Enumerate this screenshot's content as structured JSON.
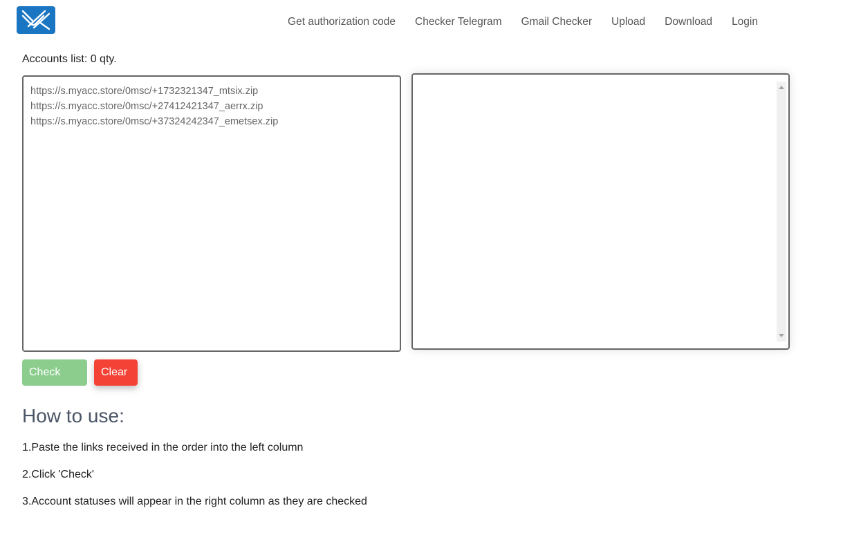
{
  "nav": {
    "items": [
      {
        "label": "Get authorization code"
      },
      {
        "label": "Checker Telegram"
      },
      {
        "label": "Gmail Checker"
      },
      {
        "label": "Upload"
      },
      {
        "label": "Download"
      },
      {
        "label": "Login"
      }
    ]
  },
  "accounts_label": "Accounts list: 0 qty.",
  "input_links_placeholder": "https://s.myacc.store/0msc/+1732321347_mtsix.zip\nhttps://s.myacc.store/0msc/+27412421347_aerrx.zip\nhttps://s.myacc.store/0msc/+37324242347_emetsex.zip",
  "results_value": "",
  "buttons": {
    "check": "Check",
    "clear": "Clear"
  },
  "howto": {
    "title": "How to use:",
    "steps": [
      "1.Paste the links received in the order into the left column",
      "2.Click 'Check'",
      "3.Account statuses will appear in the right column as they are checked"
    ]
  },
  "colors": {
    "logo": "#1a76c2",
    "check_button": "#8ccd8e",
    "clear_button": "#f44336"
  },
  "icons": {
    "logo": "paperclip-logo-icon"
  }
}
